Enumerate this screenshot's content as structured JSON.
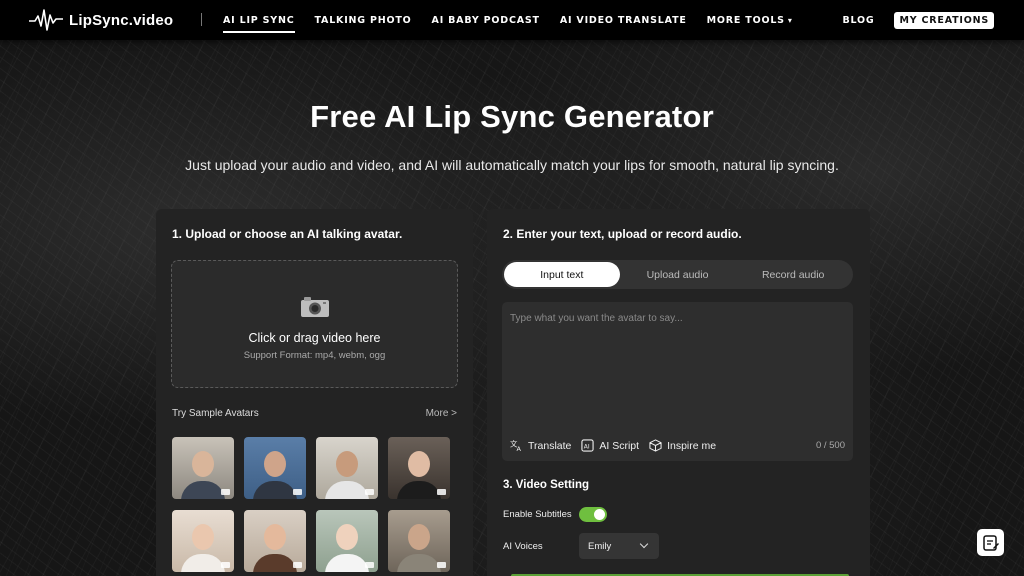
{
  "nav": {
    "logo_text": "LipSync.video",
    "links": [
      {
        "label": "AI LIP SYNC",
        "active": true
      },
      {
        "label": "TALKING PHOTO"
      },
      {
        "label": "AI BABY PODCAST"
      },
      {
        "label": "AI VIDEO TRANSLATE"
      },
      {
        "label": "MORE TOOLS"
      }
    ],
    "blog": "BLOG",
    "my_creations": "MY CREATIONS"
  },
  "hero": {
    "title": "Free AI Lip Sync Generator",
    "subtitle": "Just upload your audio and video, and AI will automatically match your lips for smooth, natural lip syncing."
  },
  "left_panel": {
    "title": "1. Upload or choose an AI talking avatar.",
    "dropzone_main": "Click or drag video here",
    "dropzone_sub": "Support Format: mp4, webm, ogg",
    "samples_title": "Try Sample Avatars",
    "more": "More >"
  },
  "right_panel": {
    "title": "2. Enter your text, upload or record audio.",
    "tabs": [
      {
        "label": "Input text",
        "active": true
      },
      {
        "label": "Upload audio"
      },
      {
        "label": "Record audio"
      }
    ],
    "placeholder": "Type what you want the avatar to say...",
    "tools": {
      "translate": "Translate",
      "ai_script": "AI Script",
      "inspire": "Inspire me"
    },
    "char_count": "0 / 500",
    "video_setting_title": "3. Video Setting",
    "subtitles_label": "Enable Subtitles",
    "subtitles_enabled": true,
    "voices_label": "AI Voices",
    "voice_selected": "Emily"
  },
  "colors": {
    "accent_green": "#6fbf3f",
    "panel_bg": "#232323",
    "nav_bg": "#000000"
  }
}
